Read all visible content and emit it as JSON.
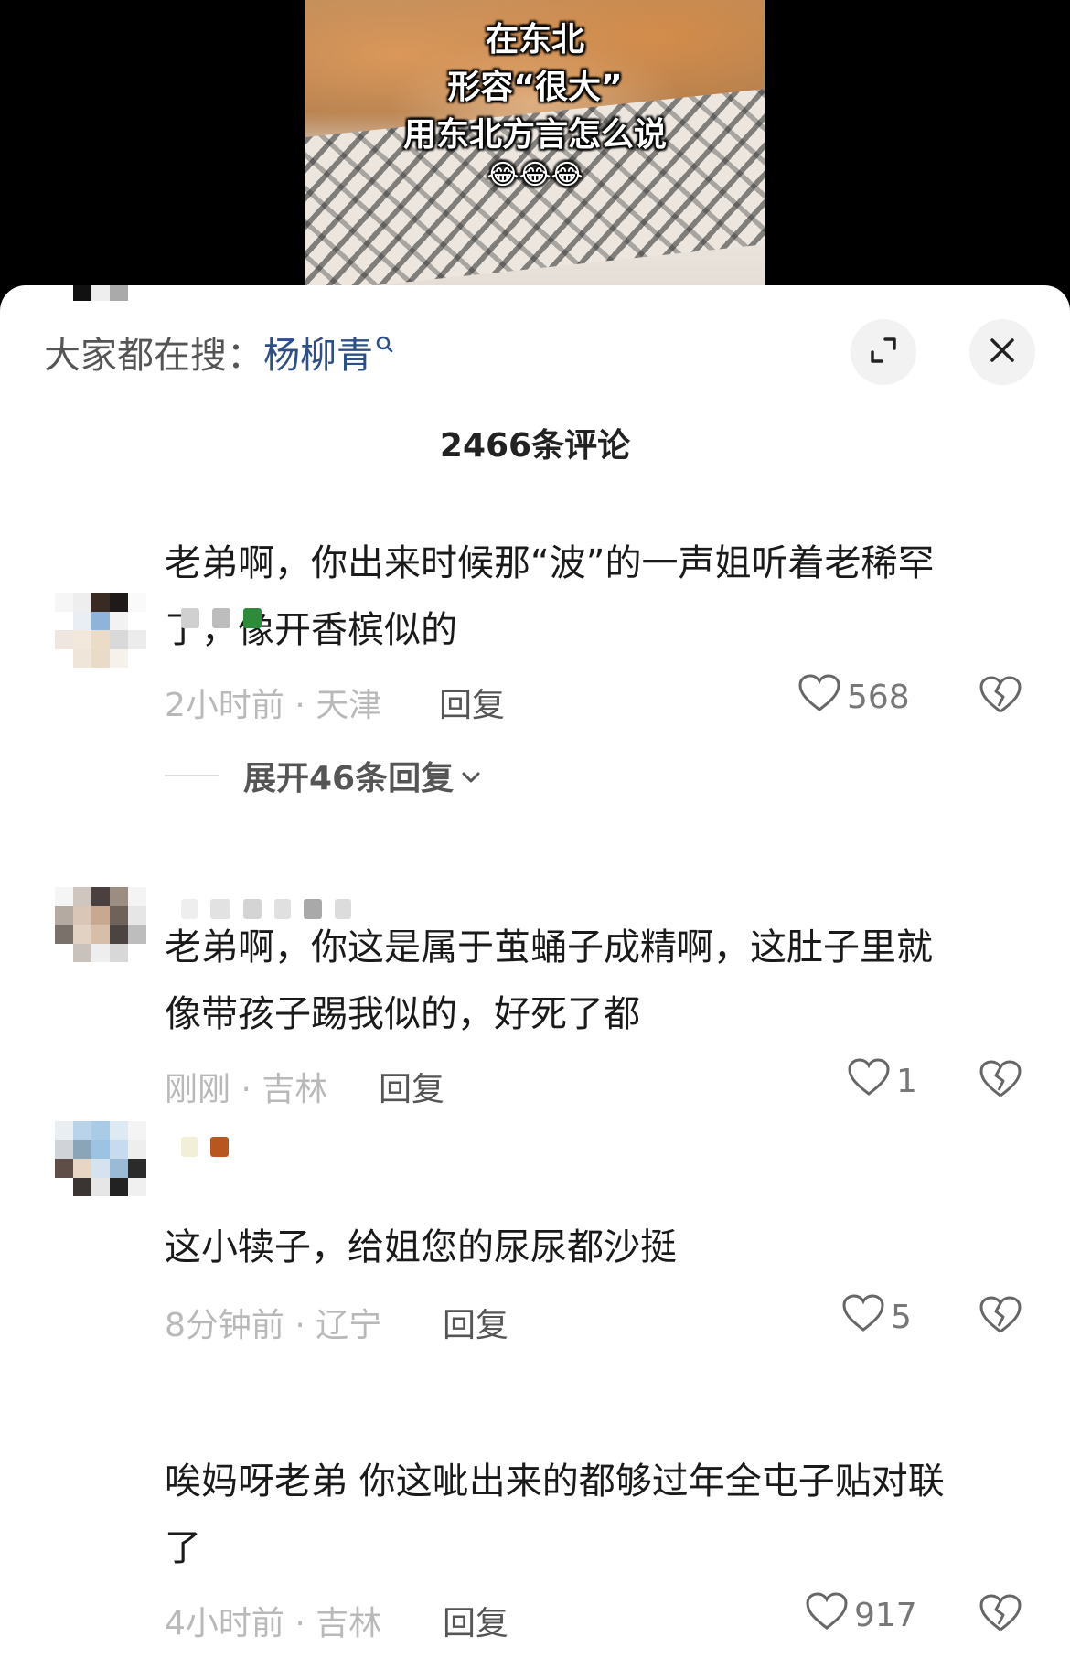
{
  "video": {
    "overlay_lines": [
      "在东北",
      "形容“很大”",
      "用东北方言怎么说"
    ],
    "overlay_emoji": "😂😂😂"
  },
  "sheet": {
    "search_prefix": "大家都在搜：",
    "search_term": "杨柳青",
    "comment_count_title": "2466条评论",
    "expand_icon": "expand-icon",
    "close_icon": "close-icon"
  },
  "comments": [
    {
      "lines": [
        "老弟啊，你出来时候那“波”的一声姐听着老稀罕",
        "了，像开香槟似的"
      ],
      "time_location": "2小时前 · 天津",
      "reply_label": "回复",
      "likes": "568",
      "expand_replies": "展开46条回复"
    },
    {
      "lines": [
        "老弟啊，你这是属于茧蛹子成精啊，这肚子里就",
        "像带孩子踢我似的，好死了都"
      ],
      "time_location": "刚刚 · 吉林",
      "reply_label": "回复",
      "likes": "1"
    },
    {
      "lines": [
        "这小犊子，给姐您的尿尿都沙挺"
      ],
      "time_location": "8分钟前 · 辽宁",
      "reply_label": "回复",
      "likes": "5"
    },
    {
      "lines": [
        "唉妈呀老弟 你这呲出来的都够过年全屯子贴对联",
        "了"
      ],
      "time_location": "4小时前 · 吉林",
      "reply_label": "回复",
      "likes": "917"
    }
  ],
  "colors": {
    "search_term": "#2b4f86",
    "meta_gray": "#b9b9b9",
    "text": "#1a1a1a"
  }
}
